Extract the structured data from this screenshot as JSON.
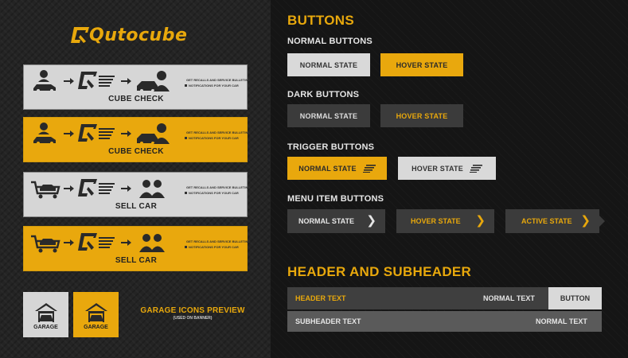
{
  "brand": {
    "logo_text": "Qutocube",
    "accent": "#e9a80d"
  },
  "left": {
    "cards": [
      {
        "label": "CUBE CHECK",
        "style": "gray",
        "kind": "car",
        "notes": [
          "GET RECALLS AND SERVICE BULLETINS",
          "NOTIFICATIONS FOR YOUR CAR"
        ]
      },
      {
        "label": "CUBE CHECK",
        "style": "orange",
        "kind": "car",
        "notes": [
          "GET RECALLS AND SERVICE BULLETINS",
          "NOTIFICATIONS FOR YOUR CAR"
        ]
      },
      {
        "label": "SELL CAR",
        "style": "gray",
        "kind": "sell",
        "notes": [
          "GET RECALLS AND SERVICE BULLETINS",
          "NOTIFICATIONS FOR YOUR CAR"
        ]
      },
      {
        "label": "SELL CAR",
        "style": "orange",
        "kind": "sell",
        "notes": [
          "GET RECALLS AND SERVICE BULLETINS",
          "NOTIFICATIONS FOR YOUR CAR"
        ]
      }
    ],
    "garage": {
      "icon_label": "GARAGE",
      "title": "GARAGE ICONS PREVIEW",
      "subtitle": "(USED ON BANNER)"
    }
  },
  "right": {
    "buttons_title": "BUTTONS",
    "normal_buttons": {
      "title": "NORMAL BUTTONS",
      "normal": "NORMAL STATE",
      "hover": "HOVER STATE"
    },
    "dark_buttons": {
      "title": "DARK BUTTONS",
      "normal": "NORMAL STATE",
      "hover": "HOVER STATE"
    },
    "trigger_buttons": {
      "title": "TRIGGER BUTTONS",
      "normal": "NORMAL STATE",
      "hover": "HOVER STATE"
    },
    "menu_item_buttons": {
      "title": "MENU ITEM BUTTONS",
      "normal": "NORMAL STATE",
      "hover": "HOVER STATE",
      "active": "ACTIVE STATE",
      "chevron": "❯"
    },
    "header_title": "HEADER AND SUBHEADER",
    "header_row": {
      "left": "HEADER TEXT",
      "middle": "NORMAL TEXT",
      "button": "BUTTON"
    },
    "subheader_row": {
      "left": "SUBHEADER TEXT",
      "right": "NORMAL TEXT"
    }
  }
}
